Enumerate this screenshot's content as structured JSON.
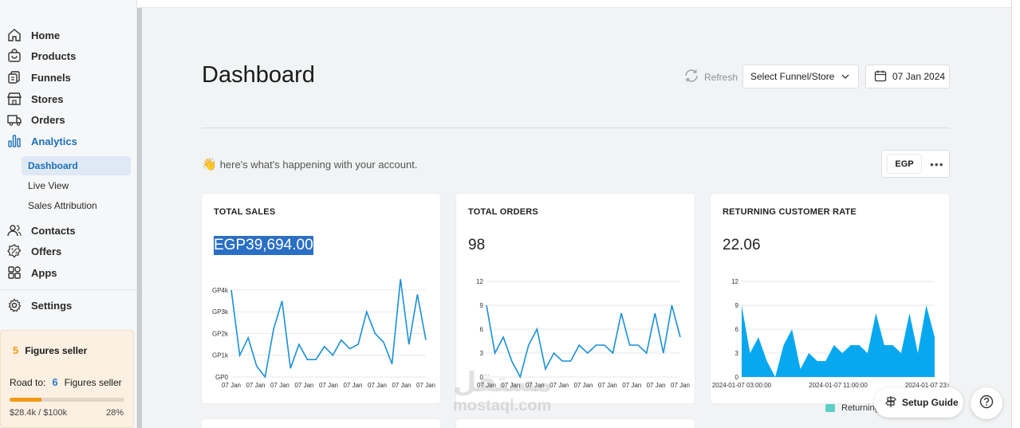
{
  "sidebar": {
    "items": [
      {
        "label": "Home",
        "icon": "home-icon"
      },
      {
        "label": "Products",
        "icon": "bag-icon"
      },
      {
        "label": "Funnels",
        "icon": "funnel-icon"
      },
      {
        "label": "Stores",
        "icon": "store-icon"
      },
      {
        "label": "Orders",
        "icon": "truck-icon"
      },
      {
        "label": "Analytics",
        "icon": "bar-chart-icon",
        "active": true
      },
      {
        "label": "Contacts",
        "icon": "contacts-icon"
      },
      {
        "label": "Offers",
        "icon": "discount-icon"
      },
      {
        "label": "Apps",
        "icon": "apps-icon"
      },
      {
        "label": "Settings",
        "icon": "gear-icon"
      }
    ],
    "sub_items": [
      {
        "label": "Dashboard",
        "active": true
      },
      {
        "label": "Live View"
      },
      {
        "label": "Sales Attribution"
      }
    ],
    "seller": {
      "level": "5",
      "title": "Figures seller",
      "road_label": "Road to:",
      "next_level": "6",
      "next_title": "Figures seller",
      "progress": 0.28,
      "amount": "$28.4k / $100k",
      "percent": "28%"
    }
  },
  "header": {
    "title": "Dashboard",
    "refresh_label": "Refresh",
    "store_select": "Select Funnel/Store",
    "date": "07 Jan 2024"
  },
  "greeting": "here's what's happening with your account.",
  "currency": "EGP",
  "cards": [
    {
      "title": "TOTAL SALES",
      "value": "EGP39,694.00"
    },
    {
      "title": "TOTAL ORDERS",
      "value": "98"
    },
    {
      "title": "RETURNING CUSTOMER RATE",
      "value": "22.06",
      "legend": "Returning"
    }
  ],
  "setup_guide": "Setup Guide",
  "watermark": {
    "arabic": "مستقل",
    "latin": "mostaql.com"
  },
  "colors": {
    "accent": "#1d6fb8",
    "line": "#1a8fd6",
    "area": "#07a8f0",
    "seller_orange": "#f29a15"
  },
  "chart_data": [
    {
      "type": "line",
      "title": "TOTAL SALES",
      "ytick_labels": [
        "GP0",
        "GP1k",
        "GP2k",
        "GP3k",
        "GP4k"
      ],
      "ylim": [
        0,
        4400
      ],
      "x": [
        "07 Jan",
        "07 Jan",
        "07 Jan",
        "07 Jan",
        "07 Jan",
        "07 Jan",
        "07 Jan",
        "07 Jan",
        "07 Jan"
      ],
      "values": [
        4000,
        1000,
        1800,
        500,
        0,
        2200,
        3500,
        400,
        1500,
        800,
        800,
        1400,
        1000,
        1700,
        1300,
        1500,
        3000,
        2000,
        1600,
        600,
        4500,
        1500,
        3800,
        1700
      ],
      "grid": true
    },
    {
      "type": "line",
      "title": "TOTAL ORDERS",
      "yticks": [
        0,
        3,
        6,
        9,
        12
      ],
      "ylim": [
        0,
        12
      ],
      "x": [
        "07 Jan",
        "07 Jan",
        "07 Jan",
        "07 Jan",
        "07 Jan",
        "07 Jan",
        "07 Jan",
        "07 Jan",
        "07 Jan"
      ],
      "values": [
        9,
        3,
        5,
        2,
        0,
        4,
        6,
        1,
        3,
        2,
        2,
        4,
        3,
        4,
        4,
        3,
        8,
        4,
        4,
        3,
        8,
        3,
        9,
        5
      ],
      "grid": true
    },
    {
      "type": "area",
      "title": "RETURNING CUSTOMER RATE",
      "yticks": [
        0,
        3,
        6,
        9,
        12
      ],
      "ylim": [
        0,
        12
      ],
      "x": [
        "2024-01-07 03:00:00",
        "2024-01-07 11:00:00",
        "2024-01-07 23:00:00"
      ],
      "series": [
        {
          "name": "Returning",
          "values": [
            9,
            3,
            5,
            2,
            0,
            4,
            6,
            1,
            3,
            2,
            2,
            4,
            3,
            4,
            4,
            3,
            8,
            4,
            4,
            3,
            8,
            3,
            9,
            5
          ]
        }
      ],
      "grid": true
    }
  ]
}
